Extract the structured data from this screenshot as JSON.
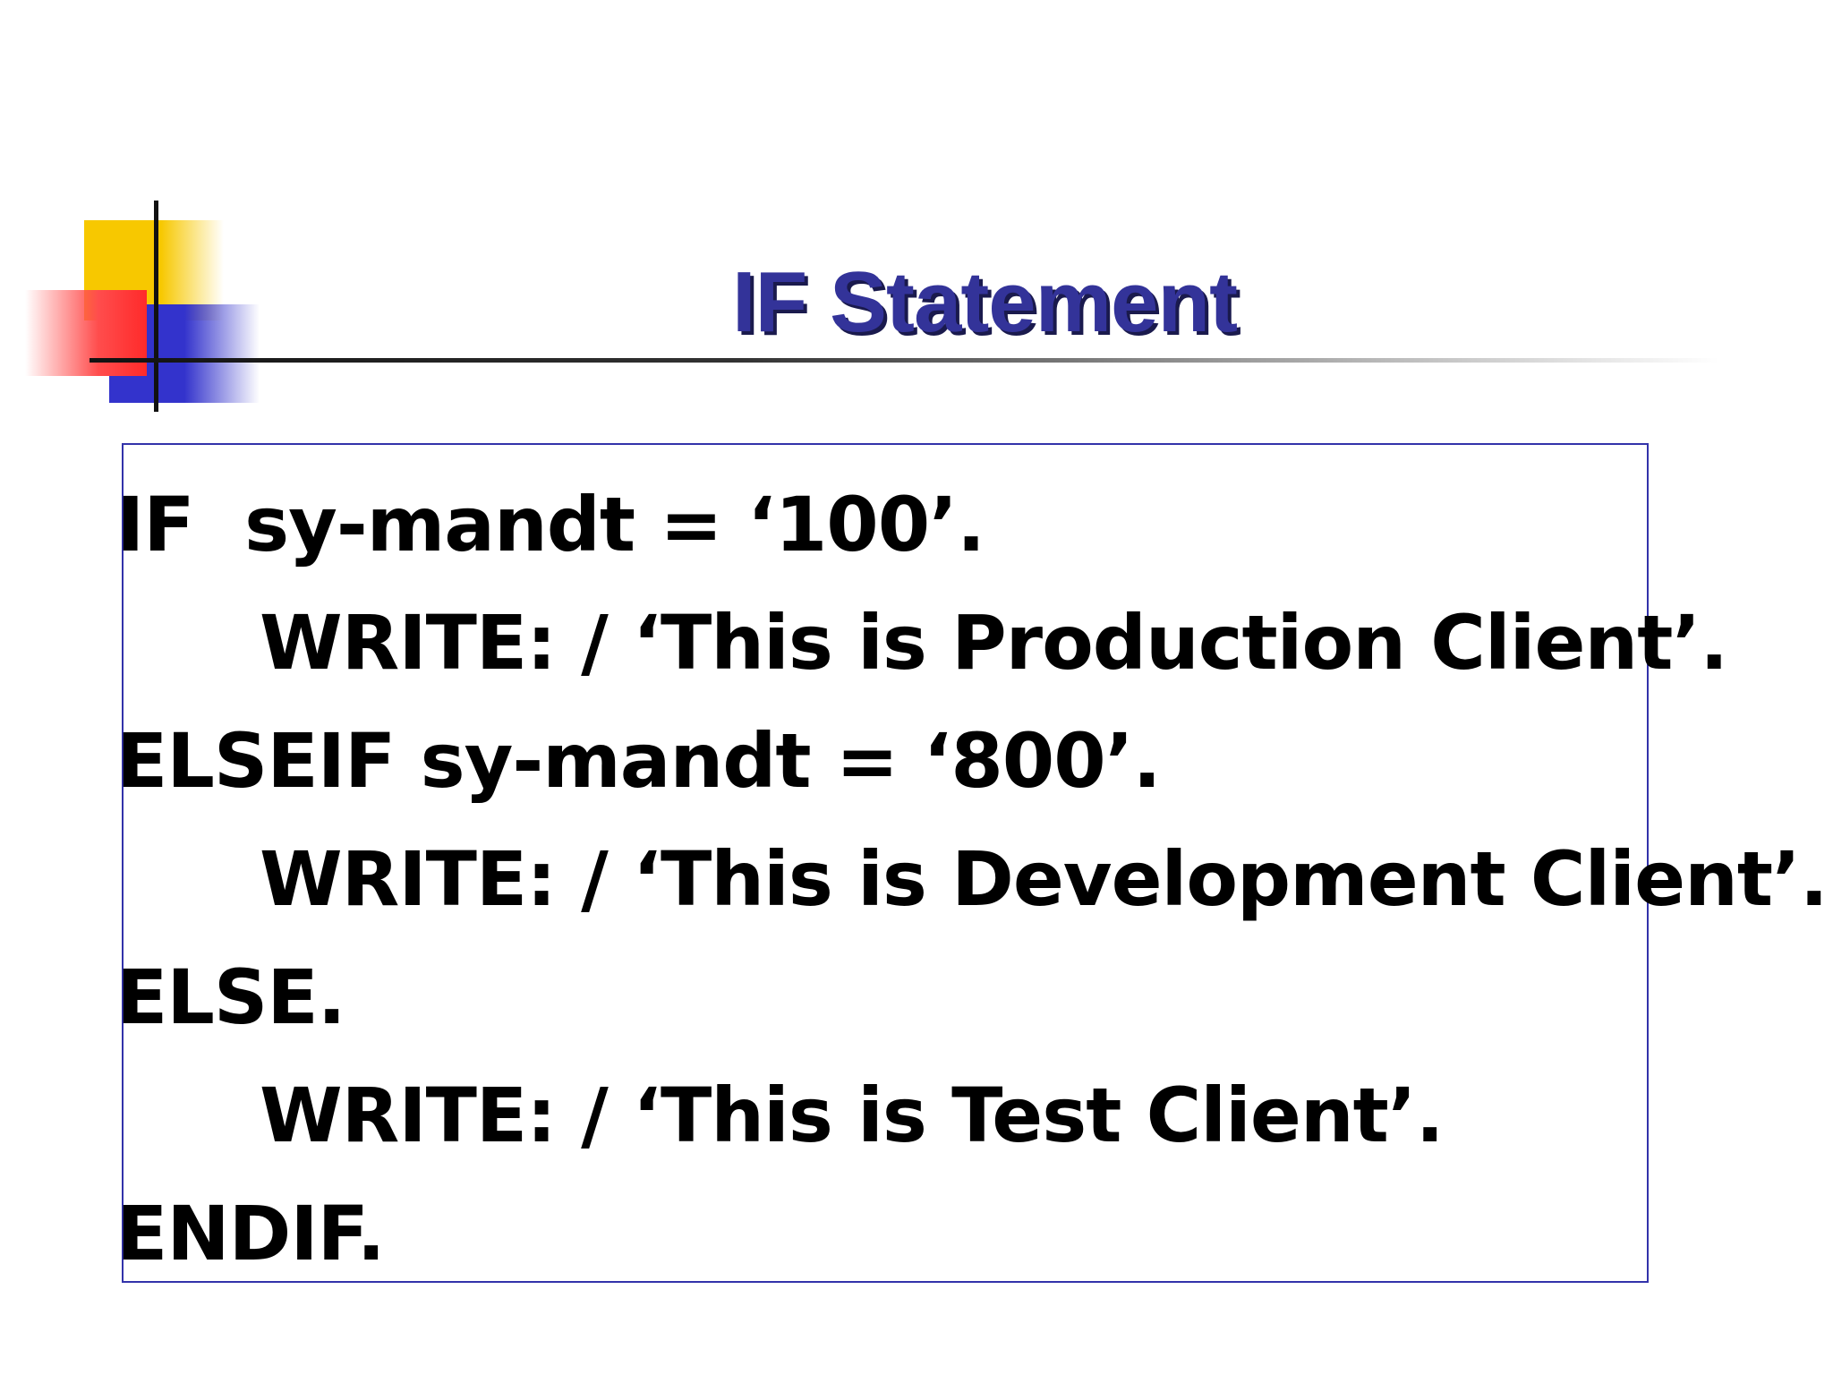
{
  "slide": {
    "title": "IF Statement",
    "code_lines": [
      "IF  sy-mandt = ‘100’.",
      "WRITE: / ‘This is Production Client’.",
      "ELSEIF sy-mandt = ‘800’.",
      "WRITE: / ‘This is Development Client’.",
      "ELSE.",
      "WRITE: / ‘This is Test Client’.",
      "ENDIF."
    ]
  },
  "colors": {
    "title": "#333399",
    "box_border": "#3333aa",
    "logo_yellow": "#f7c800",
    "logo_blue": "#3333cc",
    "logo_red": "#ff2a2a"
  }
}
